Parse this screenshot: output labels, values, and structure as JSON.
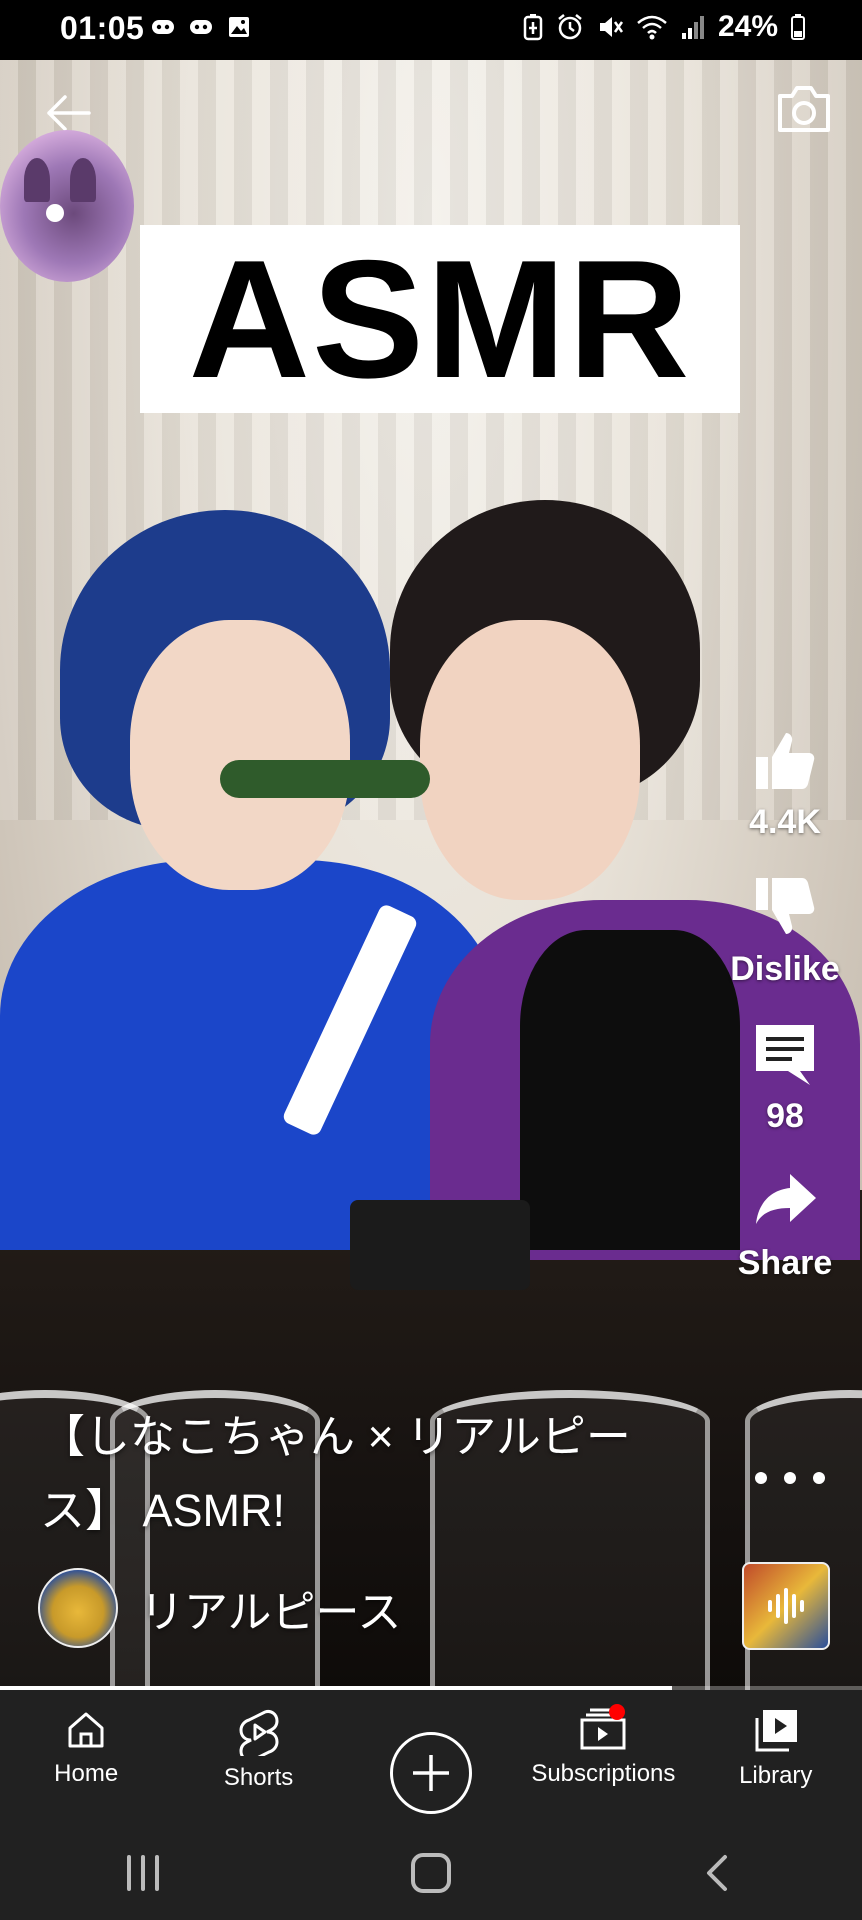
{
  "status_bar": {
    "time": "01:05",
    "battery": "24%",
    "left_icons": [
      "discord-icon",
      "discord-icon",
      "gallery-icon"
    ],
    "right_icons": [
      "battery-saver-icon",
      "alarm-icon",
      "mute-icon",
      "wifi-icon",
      "signal-icon",
      "battery-icon"
    ]
  },
  "video": {
    "banner_text": "ASMR",
    "title_line1": "【しなこちゃん × リアルピー",
    "title_line2": "ス】 ASMR!",
    "progress_fraction": 0.78
  },
  "actions": {
    "like_count": "4.4K",
    "dislike_label": "Dislike",
    "comment_count": "98",
    "share_label": "Share"
  },
  "channel": {
    "name": "リアルピース"
  },
  "bottom_nav": {
    "home": "Home",
    "shorts": "Shorts",
    "subscriptions": "Subscriptions",
    "library": "Library"
  },
  "colors": {
    "nav_bg": "#212121",
    "badge": "#ff0000",
    "text": "#ffffff"
  }
}
